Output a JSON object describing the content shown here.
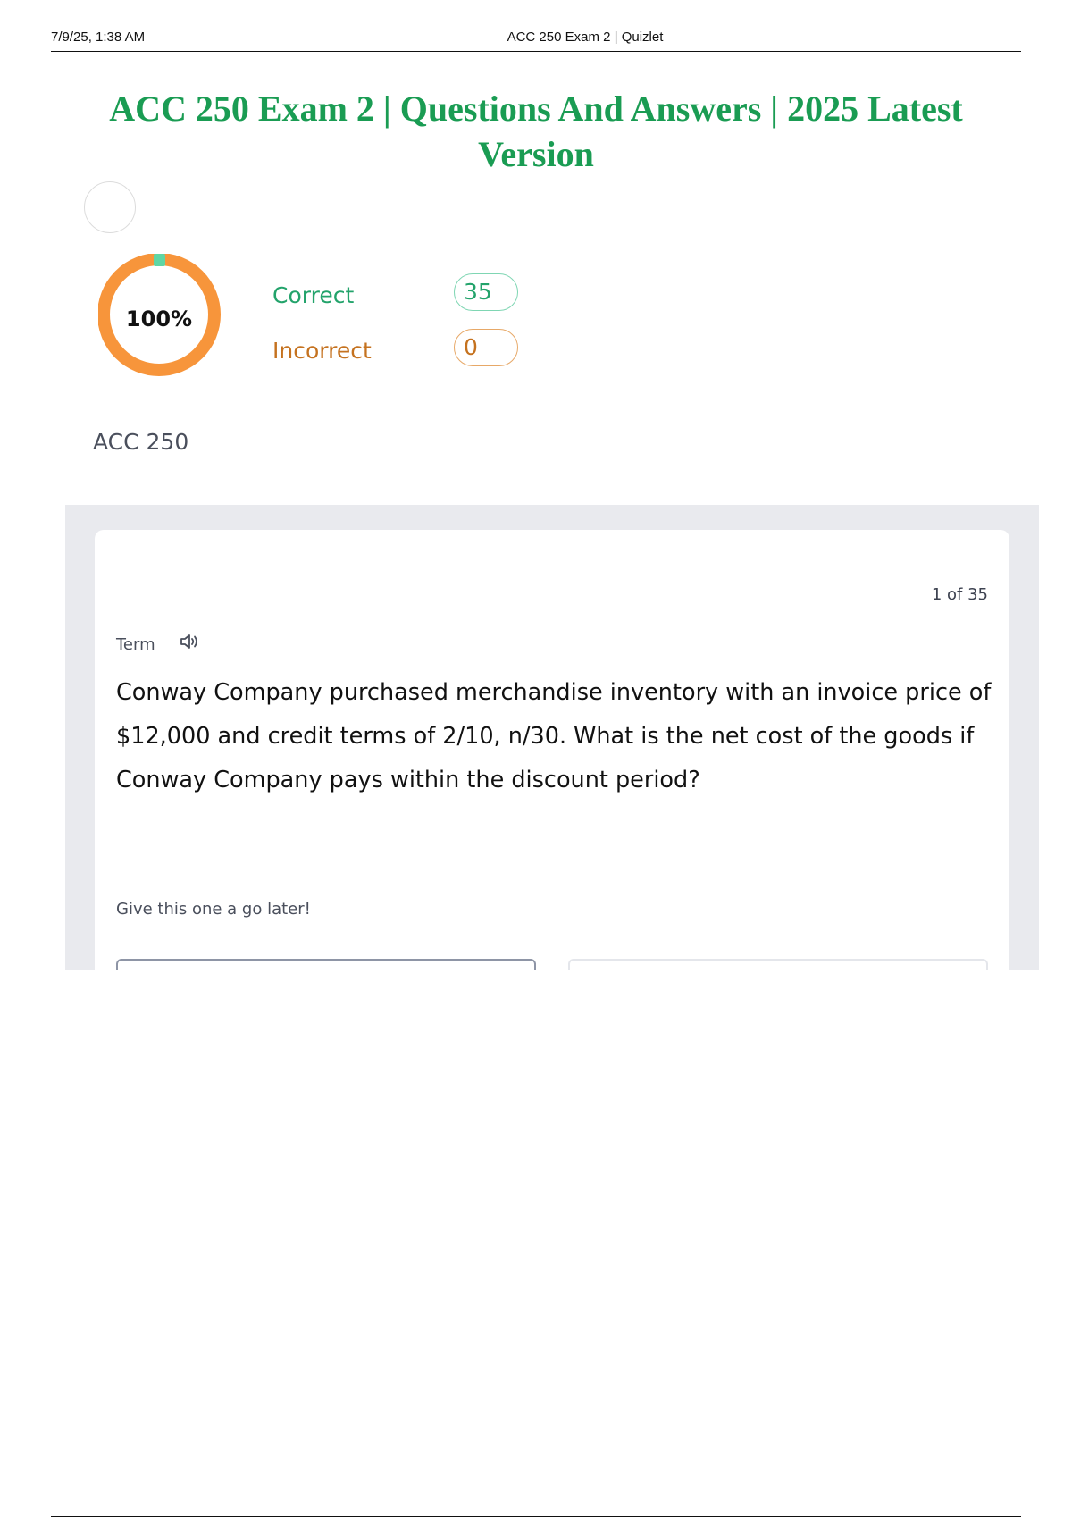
{
  "print_header": {
    "date": "7/9/25, 1:38 AM",
    "title": "ACC 250 Exam 2 | Quizlet"
  },
  "document": {
    "title": "ACC 250 Exam 2 | Questions And Answers | 2025 Latest Version"
  },
  "results": {
    "percent_label": "100%",
    "percent_value": 100,
    "correct_label": "Correct",
    "correct_count": "35",
    "incorrect_label": "Incorrect",
    "incorrect_count": "0",
    "colors": {
      "correct": "#23a36b",
      "incorrect": "#c5721f",
      "ring": "#f7953b",
      "ring_marker": "#5fd6a4"
    }
  },
  "subject": "ACC 250",
  "card": {
    "counter": "1 of 35",
    "term_label": "Term",
    "audio_icon": "speaker-icon",
    "question": "Conway Company purchased merchandise inventory with an invoice price of $12,000 and credit terms of 2/10, n/30. What is the net cost of the goods if Conway Company pays within the discount period?",
    "later_prompt": "Give this one a go later!"
  }
}
